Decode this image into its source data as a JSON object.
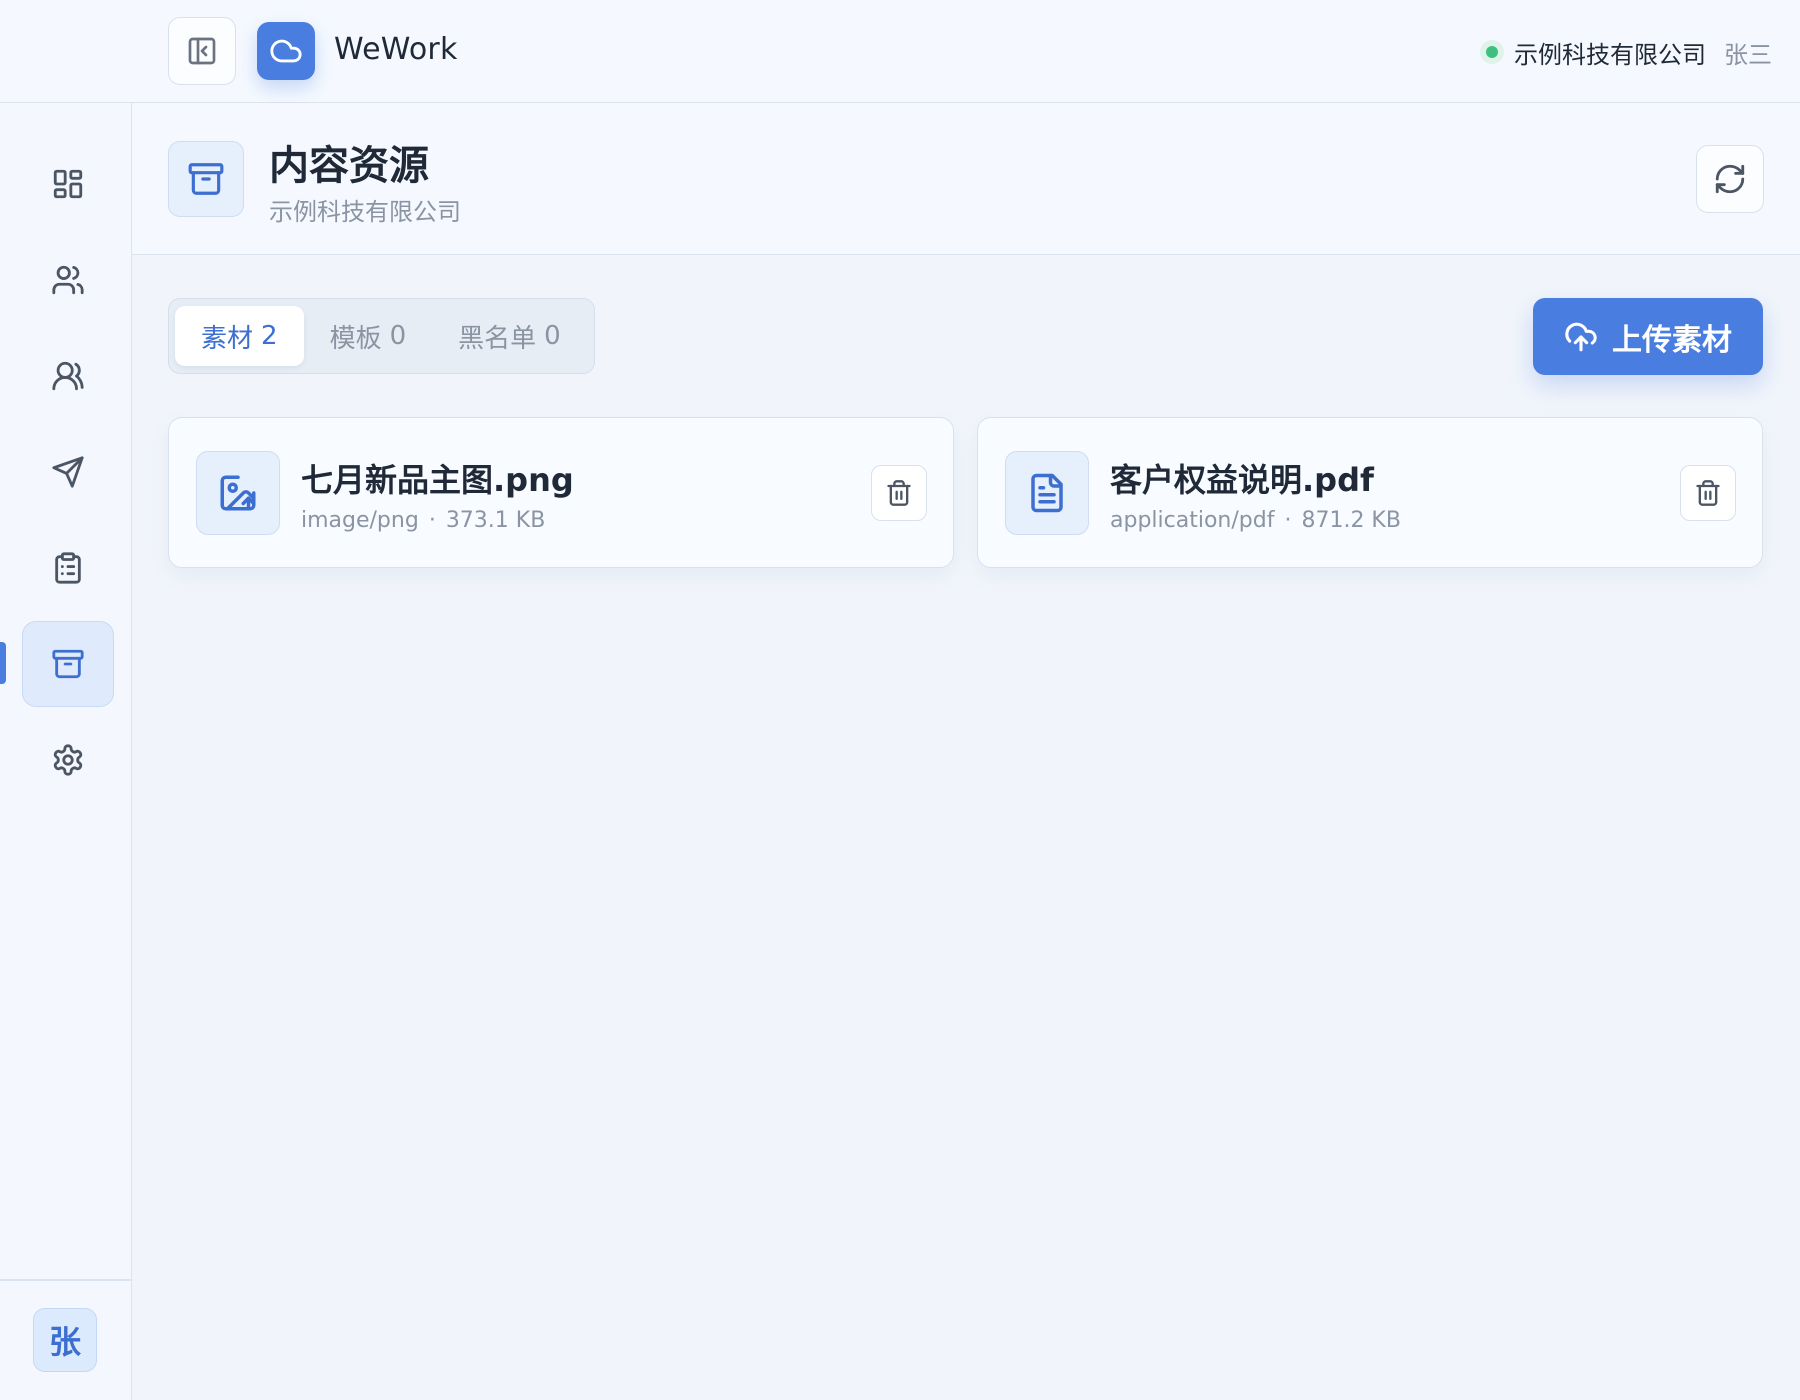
{
  "topbar": {
    "app_title": "WeWork",
    "org_name": "示例科技有限公司",
    "user_name": "张三"
  },
  "sidebar": {
    "items": [
      {
        "name": "dashboard",
        "icon": "grid-icon",
        "active": false
      },
      {
        "name": "customers",
        "icon": "users-icon",
        "active": false
      },
      {
        "name": "groups",
        "icon": "people-icon",
        "active": false
      },
      {
        "name": "broadcast",
        "icon": "send-icon",
        "active": false
      },
      {
        "name": "tasks",
        "icon": "clipboard-icon",
        "active": false
      },
      {
        "name": "content",
        "icon": "archive-icon",
        "active": true
      },
      {
        "name": "settings",
        "icon": "gear-icon",
        "active": false
      }
    ],
    "avatar_text": "张"
  },
  "page": {
    "title": "内容资源",
    "subtitle": "示例科技有限公司"
  },
  "tabs": [
    {
      "label": "素材",
      "count": "2",
      "active": true
    },
    {
      "label": "模板",
      "count": "0",
      "active": false
    },
    {
      "label": "黑名单",
      "count": "0",
      "active": false
    }
  ],
  "upload_label": "上传素材",
  "files": [
    {
      "name": "七月新品主图.png",
      "type": "image/png",
      "size": "373.1 KB",
      "icon": "image-upload-icon"
    },
    {
      "name": "客户权益说明.pdf",
      "type": "application/pdf",
      "size": "871.2 KB",
      "icon": "document-icon"
    }
  ],
  "meta_separator": "·",
  "colors": {
    "accent": "#4a7de0",
    "status_online": "#3fbf7f",
    "background": "#f1f5fb"
  }
}
